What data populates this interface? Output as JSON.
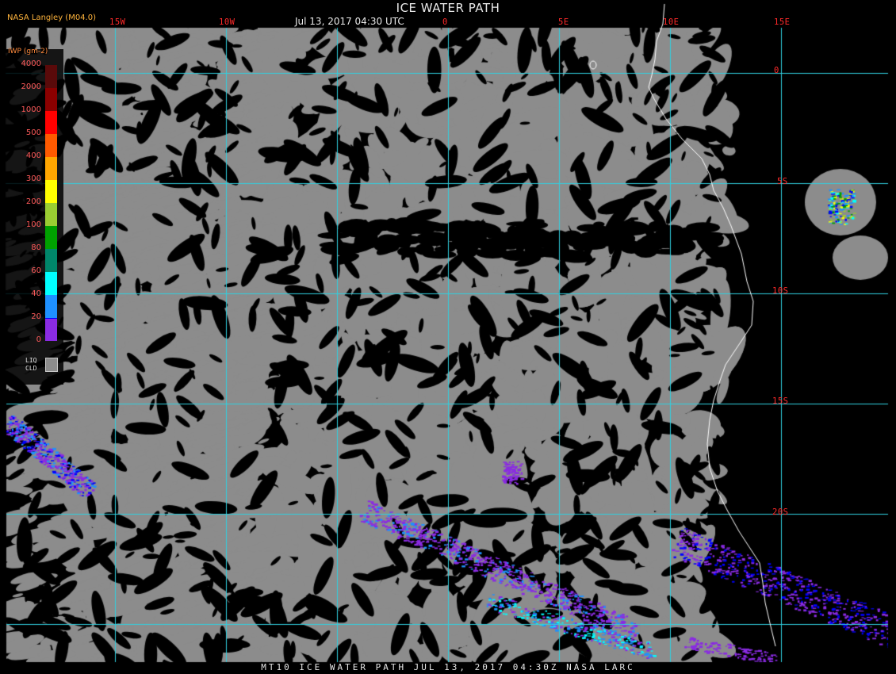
{
  "header": {
    "title": "ICE WATER PATH",
    "subtitle": "Jul 13, 2017 04:30 UTC",
    "source": "NASA Langley (M04.0)"
  },
  "footer": {
    "text": "MT10  ICE WATER PATH  JUL 13, 2017 04:30Z  NASA LARC"
  },
  "map_data": {
    "lon_labels": [
      "15W",
      "10W",
      "0",
      "5E",
      "10E",
      "15E"
    ],
    "lat_labels": [
      "0",
      "5S",
      "10S",
      "15S",
      "20S"
    ],
    "lon_range": [
      -20,
      15
    ],
    "lat_range": [
      2,
      -25
    ],
    "grid_color": "#30d0e0",
    "coast_color": "#ffffff",
    "cloud_color": "#8c8c8c",
    "background_color": "#000000"
  },
  "legend": {
    "title": "IWP (gm-2)",
    "bins": [
      {
        "label": "4000",
        "color": "#5a0a0a"
      },
      {
        "label": "2000",
        "color": "#8b0000"
      },
      {
        "label": "1000",
        "color": "#ff0000"
      },
      {
        "label": "500",
        "color": "#ff5a00"
      },
      {
        "label": "400",
        "color": "#ffa500"
      },
      {
        "label": "300",
        "color": "#ffff00"
      },
      {
        "label": "200",
        "color": "#9acd32"
      },
      {
        "label": "100",
        "color": "#00a000"
      },
      {
        "label": "80",
        "color": "#00866a"
      },
      {
        "label": "60",
        "color": "#00ffff"
      },
      {
        "label": "40",
        "color": "#1e90ff"
      },
      {
        "label": "20",
        "color": "#0000ff"
      },
      {
        "label": "0",
        "color": "#8a2be2"
      }
    ],
    "liq_line1": "LIQ",
    "liq_line2": "CLD"
  }
}
